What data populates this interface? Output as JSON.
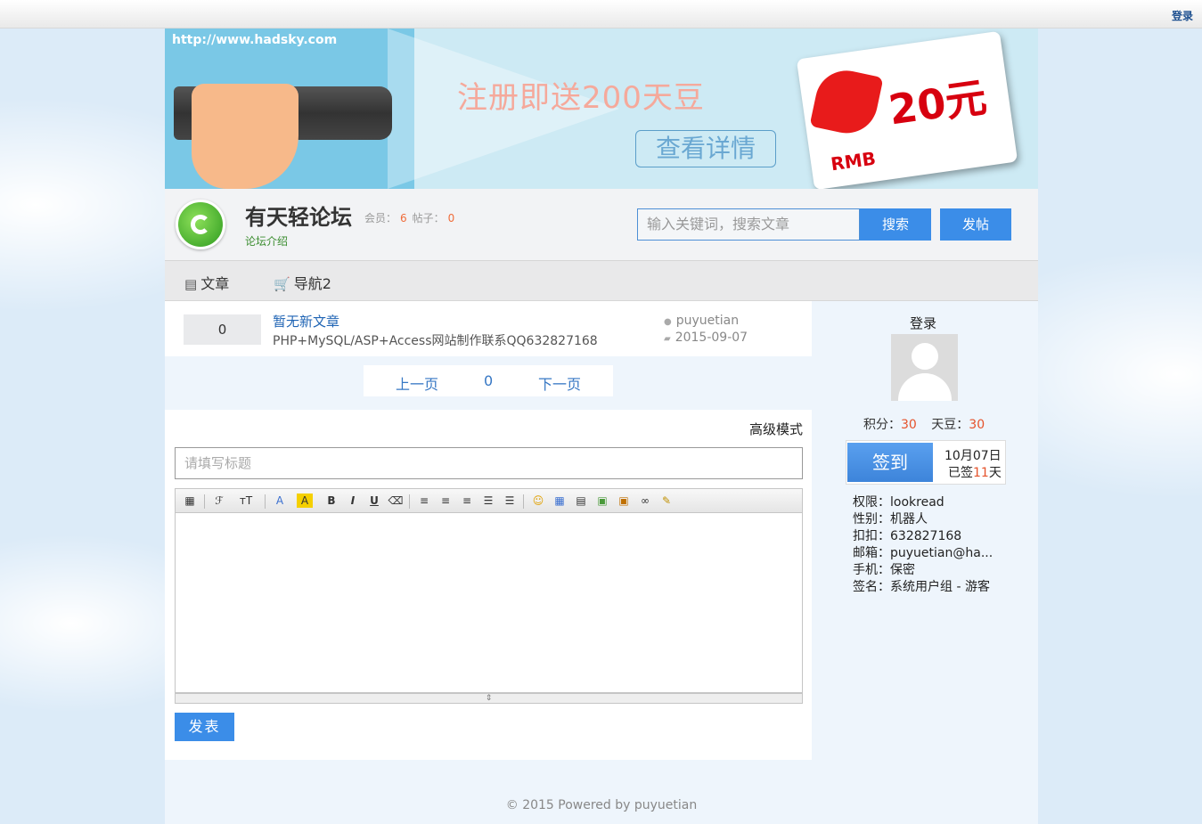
{
  "topbar": {
    "login": "登录"
  },
  "banner": {
    "url": "http://www.hadsky.com",
    "promo": "注册即送200天豆",
    "detail": "查看详情",
    "card_amount": "20元",
    "card_currency": "RMB"
  },
  "header": {
    "title": "有天轻论坛",
    "members_label": "会员：",
    "members": "6",
    "posts_label": "帖子：",
    "posts": "0",
    "intro": "论坛介绍",
    "search_placeholder": "输入关键词，搜索文章",
    "search_button": "搜索",
    "post_button": "发帖"
  },
  "nav": [
    {
      "icon": "document-icon",
      "label": "文章"
    },
    {
      "icon": "cart-icon",
      "label": "导航2"
    }
  ],
  "post": {
    "count": "0",
    "title": "暂无新文章",
    "subtitle": "PHP+MySQL/ASP+Access网站制作联系QQ632827168",
    "author": "puyuetian",
    "date": "2015-09-07"
  },
  "pager": {
    "prev": "上一页",
    "page": "0",
    "next": "下一页"
  },
  "editor": {
    "advanced": "高级模式",
    "title_placeholder": "请填写标题",
    "submit": "发表"
  },
  "sidebar": {
    "login": "登录",
    "points_label": "积分：",
    "points": "30",
    "beans_label": "天豆：",
    "beans": "30",
    "checkin_button": "签到",
    "checkin_date": "10月07日",
    "checkin_prefix": "已签",
    "checkin_days": "11",
    "checkin_suffix": "天",
    "info": [
      {
        "label": "权限：",
        "value": "lookread"
      },
      {
        "label": "性别：",
        "value": "机器人"
      },
      {
        "label": "扣扣：",
        "value": "632827168"
      },
      {
        "label": "邮箱：",
        "value": "puyuetian@ha..."
      },
      {
        "label": "手机：",
        "value": "保密"
      },
      {
        "label": "签名：",
        "value": "系统用户组 - 游客"
      }
    ]
  },
  "footer": "© 2015 Powered by puyuetian"
}
